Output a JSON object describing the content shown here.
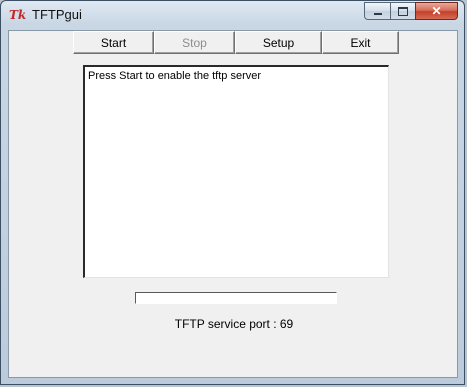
{
  "window": {
    "title": "TFTPgui",
    "icon_text": "Tk"
  },
  "caption_buttons": {
    "minimize": "minimize-icon",
    "maximize": "maximize-icon",
    "close": "✕"
  },
  "toolbar": {
    "buttons": [
      {
        "label": "Start",
        "enabled": true
      },
      {
        "label": "Stop",
        "enabled": false
      },
      {
        "label": "Setup",
        "enabled": true
      },
      {
        "label": "Exit",
        "enabled": true
      }
    ]
  },
  "output": {
    "text": "Press Start to enable the tftp server"
  },
  "progress": {
    "value": 0
  },
  "status": {
    "port_text": "TFTP service port : 69"
  },
  "colors": {
    "progress_fill": "#2b6fd6",
    "close_button": "#c4402a",
    "disabled_text": "#8d8d8d"
  }
}
